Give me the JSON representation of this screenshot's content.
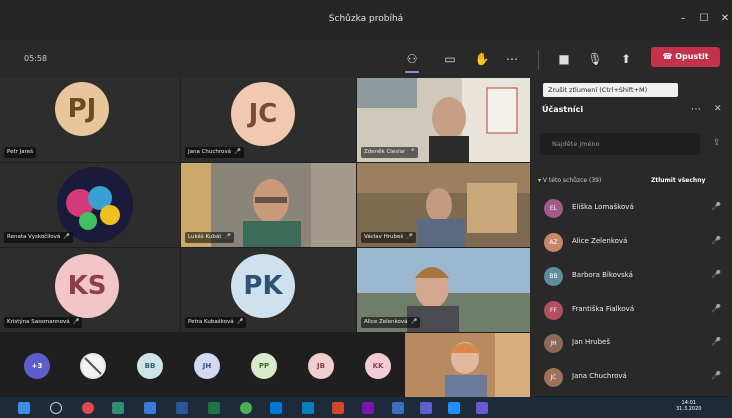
{
  "window": {
    "title": "Schůzka probíhá"
  },
  "toolbar": {
    "timer": "05:58",
    "leave_label": "Opustit",
    "tooltip": "Zrušit ztlumení (Ctrl+Shift+M)"
  },
  "tiles": [
    {
      "name": "Petr Jareš",
      "initials": "PJ",
      "type": "avatar",
      "color": "#e8c59a",
      "fg": "#6b4a25"
    },
    {
      "name": "Jana Chuchrová",
      "initials": "JC",
      "type": "avatar",
      "color": "#f0c9b0",
      "fg": "#7a4a35"
    },
    {
      "name": "Zdeněk Cieslar",
      "type": "video"
    },
    {
      "name": "Renata Vyskočilová",
      "type": "video"
    },
    {
      "name": "Lukáš Kubát",
      "type": "video"
    },
    {
      "name": "Václav Hrubeš",
      "type": "video"
    },
    {
      "name": "Kristýna Sassmannová",
      "initials": "KS",
      "type": "avatar",
      "color": "#f2c6c8",
      "fg": "#8c3f4b"
    },
    {
      "name": "Petra Kubašková",
      "initials": "PK",
      "type": "avatar",
      "color": "#cfe0ef",
      "fg": "#2e5276"
    },
    {
      "name": "Alice Zelenková",
      "type": "video"
    }
  ],
  "bottom_avatars": [
    {
      "initials": "+3",
      "color": "#5b5fc7",
      "fg": "#fff"
    },
    {
      "initials": "",
      "color": "#e6e6e6",
      "fg": "#444"
    },
    {
      "initials": "BB",
      "color": "#cde4ea",
      "fg": "#2c5f6e"
    },
    {
      "initials": "JH",
      "color": "#d2d9f0",
      "fg": "#3a4b85"
    },
    {
      "initials": "PP",
      "color": "#d6ebc9",
      "fg": "#3e6b2a"
    },
    {
      "initials": "JB",
      "color": "#f1cfcf",
      "fg": "#8a3a3a"
    },
    {
      "initials": "KK",
      "color": "#f2cdd6",
      "fg": "#8a3a52"
    }
  ],
  "panel": {
    "title": "Účastníci",
    "search_placeholder": "Najděte jméno",
    "section": "V této schůzce (39)",
    "mute_all": "Ztlumit všechny",
    "participants": [
      {
        "name": "Eliška Lomašková",
        "initials": "EL",
        "color": "#a05a8a"
      },
      {
        "name": "Alice Zelenková",
        "initials": "AZ",
        "color": "#c8876a"
      },
      {
        "name": "Barbora Bikovská",
        "initials": "BB",
        "color": "#5f8ca0"
      },
      {
        "name": "Františka Fialková",
        "initials": "FF",
        "color": "#b05060"
      },
      {
        "name": "Jan Hrubeš",
        "initials": "JH",
        "color": "#8a6a5a"
      },
      {
        "name": "Jana Chuchrová",
        "initials": "JC",
        "color": "#a0705a"
      }
    ]
  },
  "taskbar": {
    "time": "14:01",
    "date": "31.3.2020"
  }
}
